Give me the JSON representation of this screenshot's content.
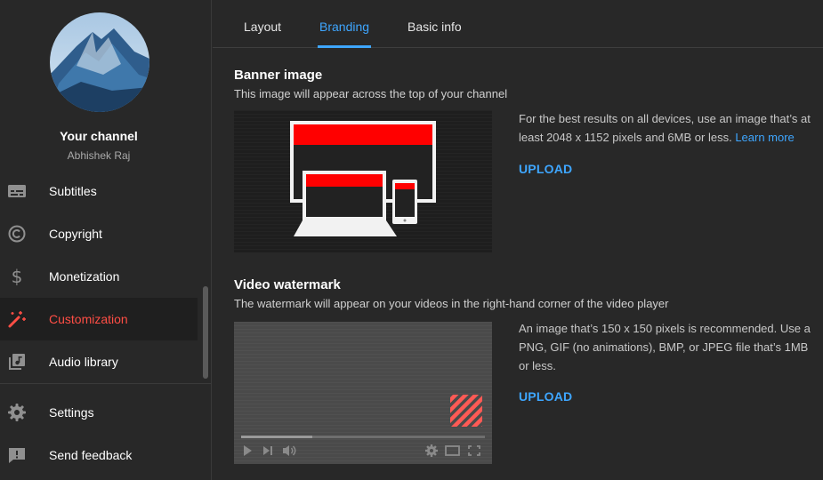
{
  "sidebar": {
    "channel_title": "Your channel",
    "channel_name": "Abhishek Raj",
    "items": [
      {
        "label": "Subtitles",
        "icon": "subtitles-icon"
      },
      {
        "label": "Copyright",
        "icon": "copyright-icon"
      },
      {
        "label": "Monetization",
        "icon": "dollar-icon"
      },
      {
        "label": "Customization",
        "icon": "magic-wand-icon",
        "active": true
      },
      {
        "label": "Audio library",
        "icon": "audio-library-icon"
      },
      {
        "label": "Settings",
        "icon": "gear-icon"
      },
      {
        "label": "Send feedback",
        "icon": "feedback-icon"
      }
    ]
  },
  "tabs": [
    {
      "label": "Layout"
    },
    {
      "label": "Branding",
      "active": true
    },
    {
      "label": "Basic info"
    }
  ],
  "banner": {
    "title": "Banner image",
    "description": "This image will appear across the top of your channel",
    "info": "For the best results on all devices, use an image that’s at least 2048 x 1152 pixels and 6MB or less.",
    "learn_more": "Learn more",
    "upload": "UPLOAD"
  },
  "watermark": {
    "title": "Video watermark",
    "description": "The watermark will appear on your videos in the right-hand corner of the video player",
    "info": "An image that’s 150 x 150 pixels is recommended. Use a PNG, GIF (no animations), BMP, or JPEG file that’s 1MB or less.",
    "upload": "UPLOAD"
  },
  "colors": {
    "accent": "#3ea6ff",
    "active_nav": "#ff4e45",
    "brand_red": "#ff0000"
  }
}
